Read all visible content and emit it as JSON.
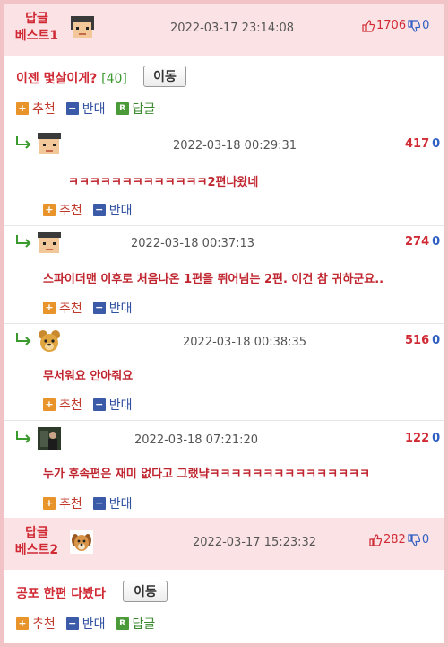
{
  "best1": {
    "label_line1": "답글",
    "label_line2": "베스트1",
    "timestamp": "2022-03-17 23:14:08",
    "up": "1706",
    "down": "0",
    "title": "이젠 몇살이게?",
    "count": "[40]",
    "move_label": "이동",
    "recommend_label": "추천",
    "oppose_label": "반대",
    "reply_label": "답글",
    "avatar": "pixel-face-avatar"
  },
  "replies": [
    {
      "timestamp": "2022-03-18 00:29:31",
      "up": "417",
      "down": "0",
      "text": "ㅋㅋㅋㅋㅋㅋㅋㅋㅋㅋㅋㅋㅋ2편나왔네",
      "avatar": "pixel-face-avatar"
    },
    {
      "timestamp": "2022-03-18 00:37:13",
      "up": "274",
      "down": "0",
      "text": "스파이더맨 이후로 처음나온 1편을 뛰어넘는 2편. 이건 참 귀하군요..",
      "avatar": "pixel-face-avatar"
    },
    {
      "timestamp": "2022-03-18 00:38:35",
      "up": "516",
      "down": "0",
      "text": "무서워요 안아줘요",
      "avatar": "bear-avatar"
    },
    {
      "timestamp": "2022-03-18 07:21:20",
      "up": "122",
      "down": "0",
      "text": "누가 후속편은 재미 없다고 그랬냨ㅋㅋㅋㅋㅋㅋㅋㅋㅋㅋㅋㅋㅋㅋㅋ",
      "avatar": "photo-avatar"
    }
  ],
  "reply_actions": {
    "recommend_label": "추천",
    "oppose_label": "반대"
  },
  "best2": {
    "label_line1": "답글",
    "label_line2": "베스트2",
    "timestamp": "2022-03-17 15:23:32",
    "up": "282",
    "down": "0",
    "title": "공포 한편 다봤다",
    "move_label": "이동",
    "recommend_label": "추천",
    "oppose_label": "반대",
    "reply_label": "답글",
    "avatar": "dog-avatar"
  },
  "colors": {
    "accent_red": "#d02a35",
    "down_blue": "#2f5fc2",
    "best_bg": "#fbe3e5",
    "border_pink": "#f2c3c6"
  }
}
